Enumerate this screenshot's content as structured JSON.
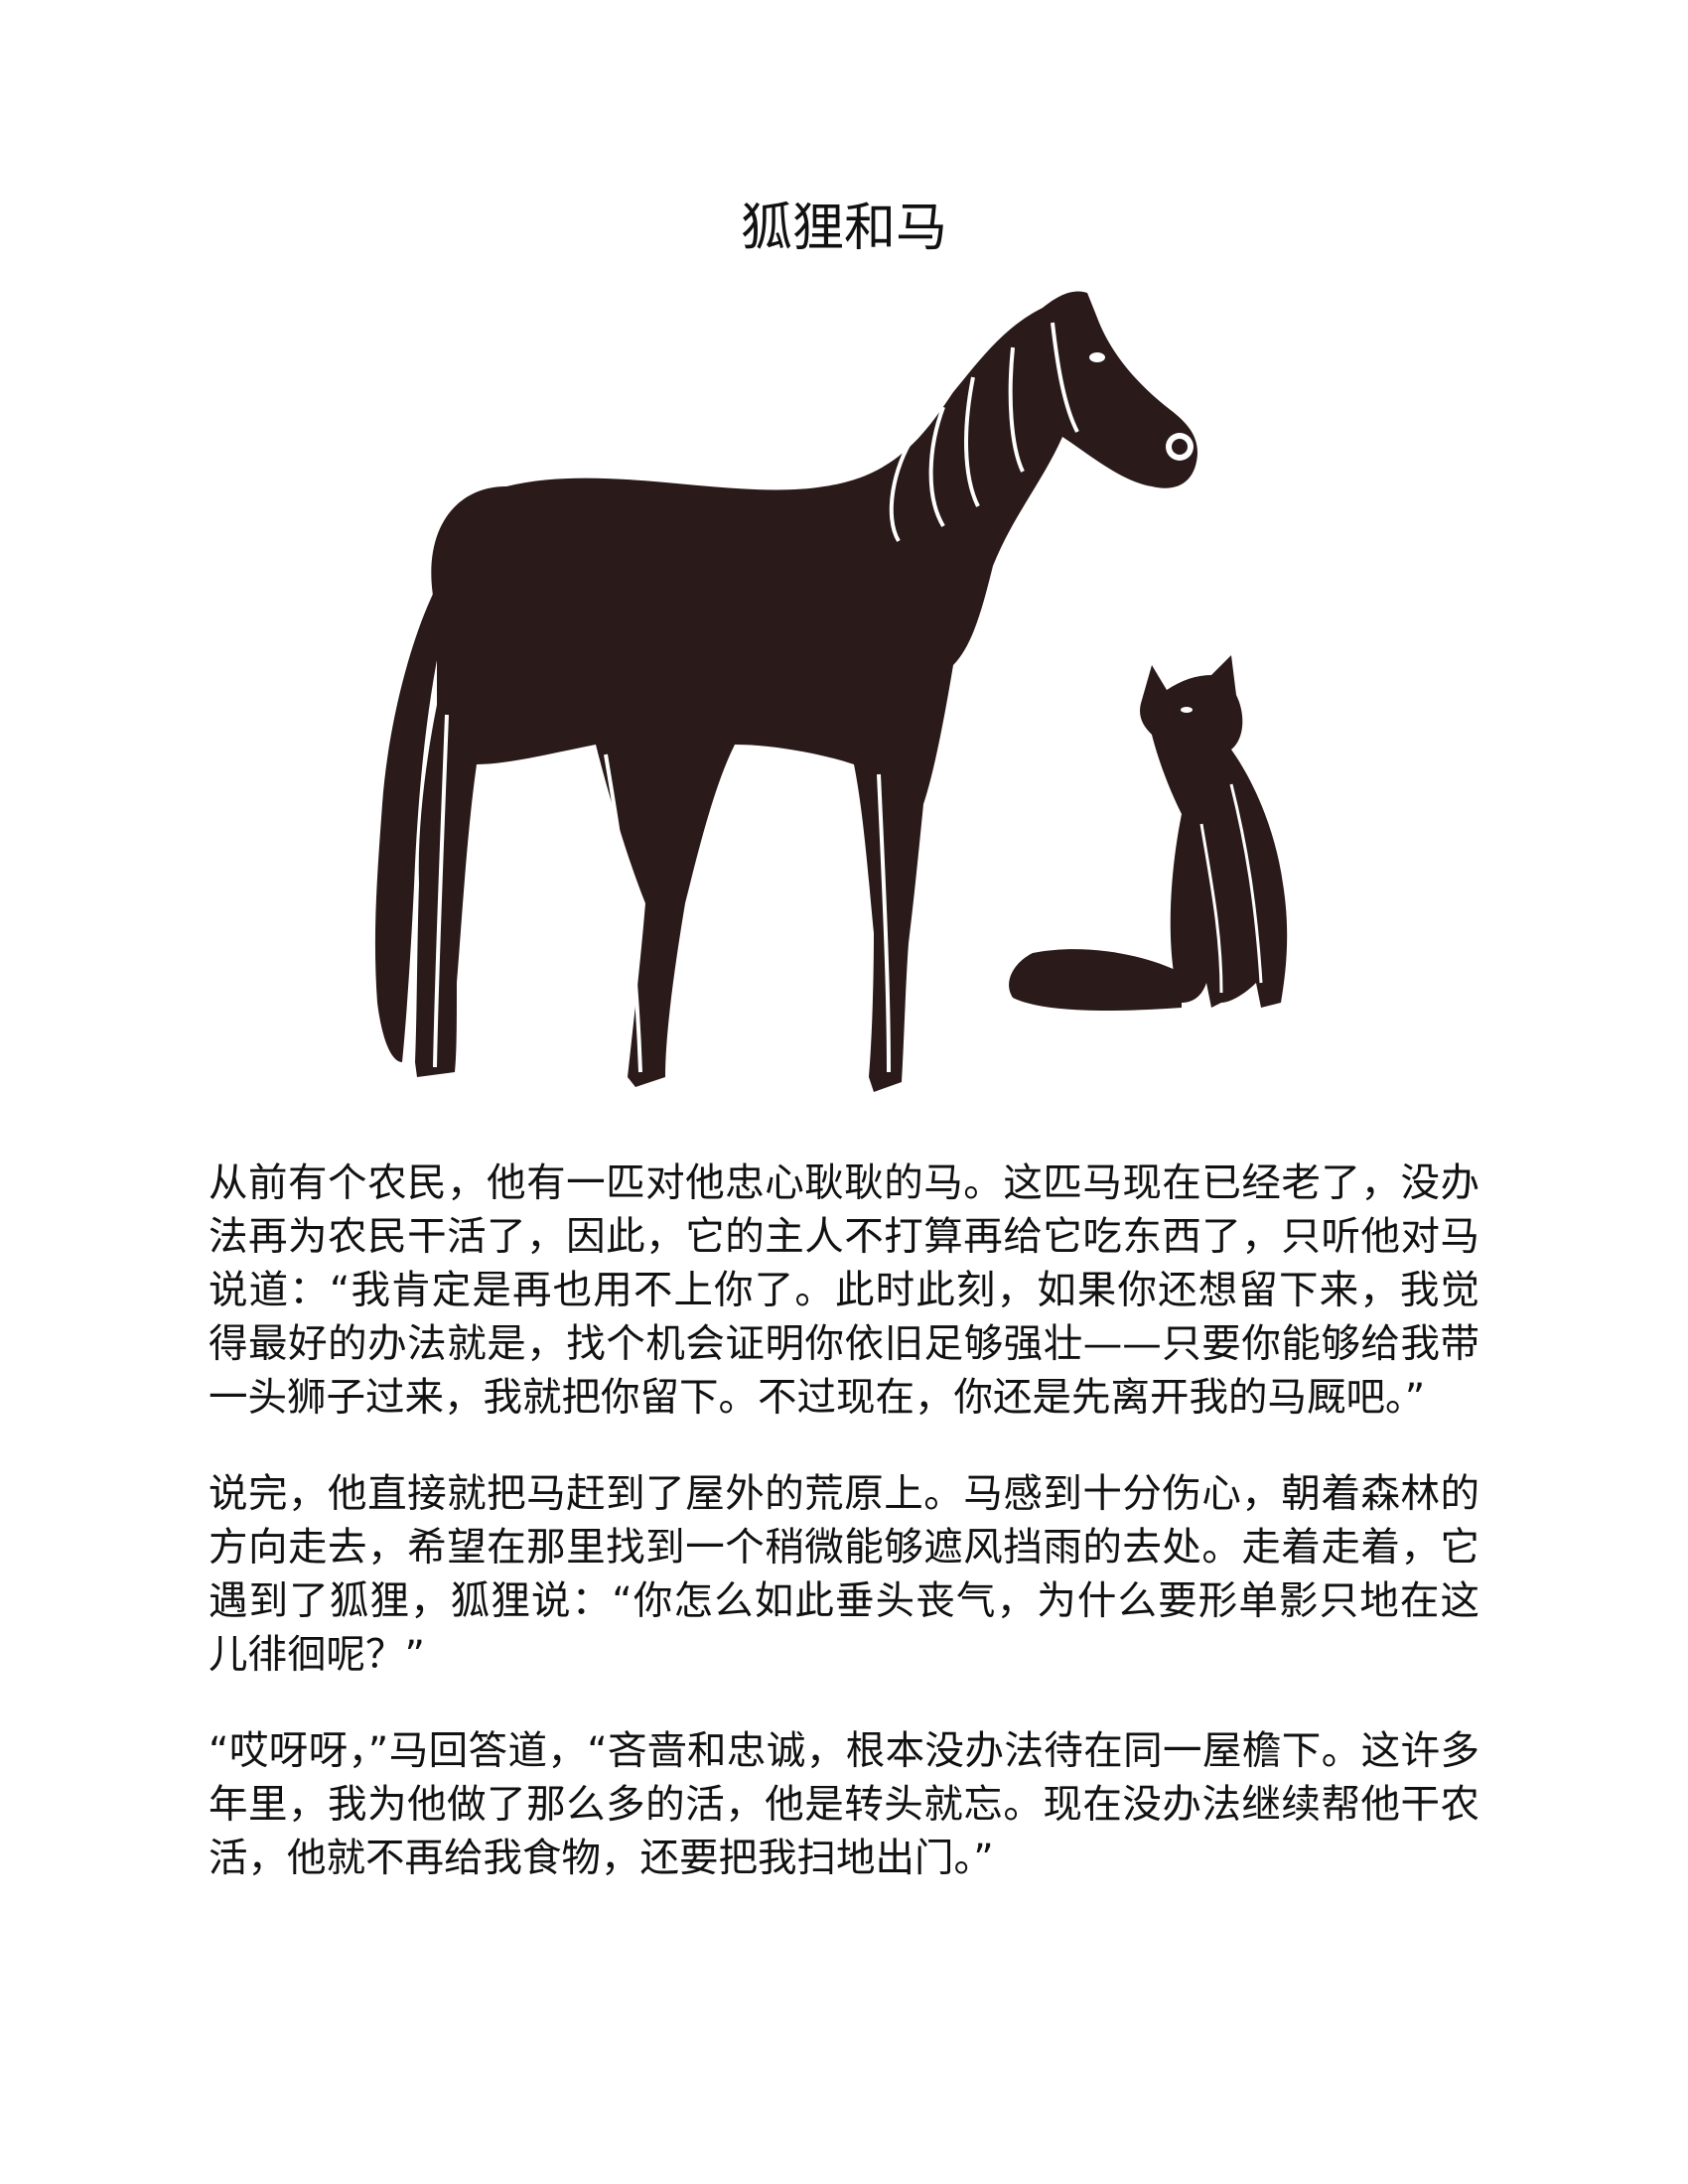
{
  "document": {
    "title": "狐狸和马",
    "paragraphs": [
      "从前有个农民，他有一匹对他忠心耿耿的马。这匹马现在已经老了，没办法再为农民干活了，因此，它的主人不打算再给它吃东西了，只听他对马说道：“我肯定是再也用不上你了。此时此刻，如果你还想留下来，我觉得最好的办法就是，找个机会证明你依旧足够强壮——只要你能够给我带一头狮子过来，我就把你留下。不过现在，你还是先离开我的马厩吧。”",
      "说完，他直接就把马赶到了屋外的荒原上。马感到十分伤心，朝着森林的方向走去，希望在那里找到一个稍微能够遮风挡雨的去处。走着走着，它遇到了狐狸，狐狸说：“你怎么如此垂头丧气，为什么要形单影只地在这儿徘徊呢？”",
      "“哎呀呀，”马回答道，“吝啬和忠诚，根本没办法待在同一屋檐下。这许多年里，我为他做了那么多的活，他是转头就忘。现在没办法继续帮他干农活，他就不再给我食物，还要把我扫地出门。”"
    ]
  },
  "colors": {
    "ink": "#2a1a1a",
    "text": "#111111",
    "background": "#ffffff"
  },
  "illustration": {
    "figures": [
      "horse-silhouette",
      "fox-silhouette"
    ]
  }
}
